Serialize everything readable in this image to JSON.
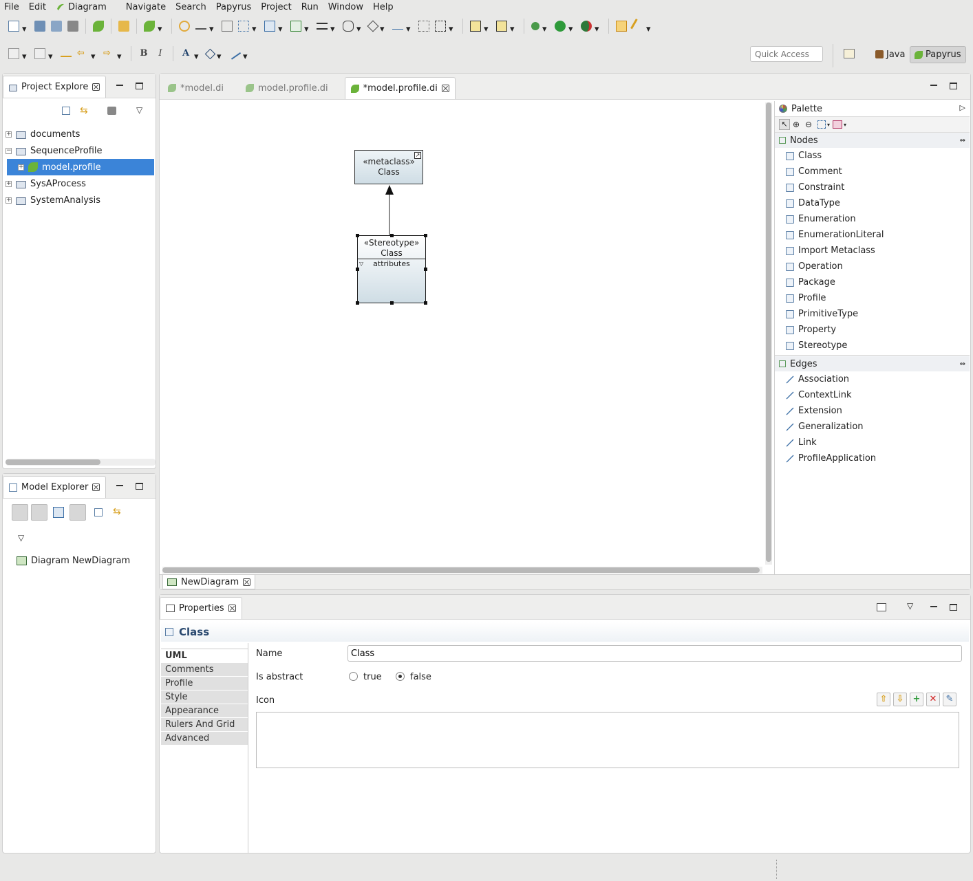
{
  "menu": [
    "File",
    "Edit",
    "Diagram",
    "Navigate",
    "Search",
    "Papyrus",
    "Project",
    "Run",
    "Window",
    "Help"
  ],
  "toolbar": {
    "quick_access_placeholder": "Quick Access",
    "perspective_java": "Java",
    "perspective_papyrus": "Papyrus",
    "bold": "B",
    "italic": "I",
    "font_letter": "A"
  },
  "project_explorer": {
    "title": "Project Explore",
    "items": [
      {
        "label": "documents",
        "expand": "+"
      },
      {
        "label": "SequenceProfile",
        "expand": "−"
      },
      {
        "label": "model.profile",
        "expand": "+"
      },
      {
        "label": "SysAProcess",
        "expand": "+"
      },
      {
        "label": "SystemAnalysis",
        "expand": "+"
      }
    ]
  },
  "model_explorer": {
    "title": "Model Explorer",
    "diagram": "Diagram NewDiagram"
  },
  "editor": {
    "tabs": [
      "*model.di",
      "model.profile.di",
      "*model.profile.di"
    ],
    "bottom_tab": "NewDiagram",
    "metaclass": {
      "stereo": "«metaclass»",
      "name": "Class"
    },
    "stereotype": {
      "stereo": "«Stereotype»",
      "name": "Class",
      "compartment": "attributes"
    }
  },
  "palette": {
    "title": "Palette",
    "nodes_label": "Nodes",
    "nodes": [
      "Class",
      "Comment",
      "Constraint",
      "DataType",
      "Enumeration",
      "EnumerationLiteral",
      "Import Metaclass",
      "Operation",
      "Package",
      "Profile",
      "PrimitiveType",
      "Property",
      "Stereotype"
    ],
    "edges_label": "Edges",
    "edges": [
      "Association",
      "ContextLink",
      "Extension",
      "Generalization",
      "Link",
      "ProfileApplication"
    ]
  },
  "properties": {
    "title": "Properties",
    "heading": "Class",
    "tabs": [
      "UML",
      "Comments",
      "Profile",
      "Style",
      "Appearance",
      "Rulers And Grid",
      "Advanced"
    ],
    "name_label": "Name",
    "name_value": "Class",
    "abstract_label": "Is abstract",
    "opt_true": "true",
    "opt_false": "false",
    "icon_label": "Icon",
    "btn_add": "+",
    "btn_remove": "✕"
  },
  "colors": {
    "selection": "#3b84d8",
    "node_fill": "#dce8ee"
  }
}
